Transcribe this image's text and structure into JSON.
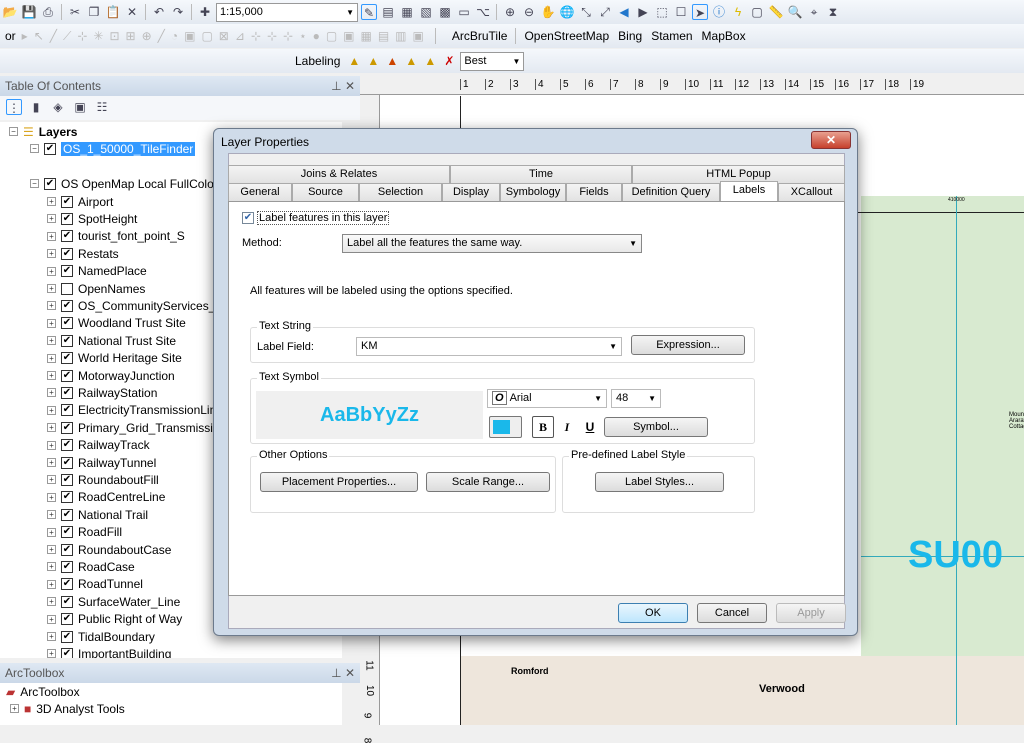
{
  "toolbar": {
    "scale": "1:15,000",
    "editor": "or",
    "arcbrutile": "ArcBruTile",
    "osm": "OpenStreetMap",
    "bing": "Bing",
    "stamen": "Stamen",
    "mapbox": "MapBox",
    "labeling": "Labeling",
    "best": "Best"
  },
  "toc": {
    "title": "Table Of Contents",
    "root": "Layers",
    "selected_layer": "OS_1_50000_TileFinder",
    "group": "OS OpenMap Local FullColour",
    "layers": [
      {
        "name": "Airport",
        "checked": true
      },
      {
        "name": "SpotHeight",
        "checked": true
      },
      {
        "name": "tourist_font_point_S",
        "checked": true
      },
      {
        "name": "Restats",
        "checked": true
      },
      {
        "name": "NamedPlace",
        "checked": true
      },
      {
        "name": "OpenNames",
        "checked": false
      },
      {
        "name": "OS_CommunityServices_Li",
        "checked": true
      },
      {
        "name": "Woodland Trust Site",
        "checked": true
      },
      {
        "name": "National Trust Site",
        "checked": true
      },
      {
        "name": "World Heritage Site",
        "checked": true
      },
      {
        "name": "MotorwayJunction",
        "checked": true
      },
      {
        "name": "RailwayStation",
        "checked": true
      },
      {
        "name": "ElectricityTransmissionLin",
        "checked": true
      },
      {
        "name": "Primary_Grid_Transmissio",
        "checked": true
      },
      {
        "name": "RailwayTrack",
        "checked": true
      },
      {
        "name": "RailwayTunnel",
        "checked": true
      },
      {
        "name": "RoundaboutFill",
        "checked": true
      },
      {
        "name": "RoadCentreLine",
        "checked": true
      },
      {
        "name": "National Trail",
        "checked": true
      },
      {
        "name": "RoadFill",
        "checked": true
      },
      {
        "name": "RoundaboutCase",
        "checked": true
      },
      {
        "name": "RoadCase",
        "checked": true
      },
      {
        "name": "RoadTunnel",
        "checked": true
      },
      {
        "name": "SurfaceWater_Line",
        "checked": true
      },
      {
        "name": "Public Right of Way",
        "checked": true
      },
      {
        "name": "TidalBoundary",
        "checked": true
      },
      {
        "name": "ImportantBuilding",
        "checked": true
      }
    ]
  },
  "toolbox": {
    "title": "ArcToolbox",
    "root": "ArcToolbox",
    "items": [
      "3D Analyst Tools"
    ]
  },
  "ruler": {
    "h": [
      "1",
      "2",
      "3",
      "4",
      "5",
      "6",
      "7",
      "8",
      "9",
      "10",
      "11",
      "12",
      "13",
      "14",
      "15",
      "16",
      "17",
      "18",
      "19"
    ],
    "v": [
      "11",
      "10",
      "9",
      "8"
    ]
  },
  "map": {
    "grid_label": "410000",
    "tile_label": "SU00",
    "places": [
      "Romford",
      "Verwood",
      "Mount Ararat Cottage"
    ]
  },
  "dialog": {
    "title": "Layer Properties",
    "tabs_row1": [
      "Joins & Relates",
      "Time",
      "HTML Popup"
    ],
    "tabs_row2": [
      "General",
      "Source",
      "Selection",
      "Display",
      "Symbology",
      "Fields",
      "Definition Query",
      "Labels",
      "XCallout"
    ],
    "active_tab": "Labels",
    "label_features": "Label features in this layer",
    "label_features_checked": true,
    "method_label": "Method:",
    "method_value": "Label all the features the same way.",
    "info": "All features will be labeled using the options specified.",
    "text_string": "Text String",
    "label_field_label": "Label Field:",
    "label_field_value": "KM",
    "expression_btn": "Expression...",
    "text_symbol": "Text Symbol",
    "preview": "AaBbYyZz",
    "font": "Arial",
    "size": "48",
    "color": "#1ab8ea",
    "bold": "B",
    "italic": "I",
    "underline": "U",
    "symbol_btn": "Symbol...",
    "other_options": "Other Options",
    "placement_btn": "Placement Properties...",
    "scale_btn": "Scale Range...",
    "predefined": "Pre-defined Label Style",
    "styles_btn": "Label Styles...",
    "ok": "OK",
    "cancel": "Cancel",
    "apply": "Apply"
  }
}
